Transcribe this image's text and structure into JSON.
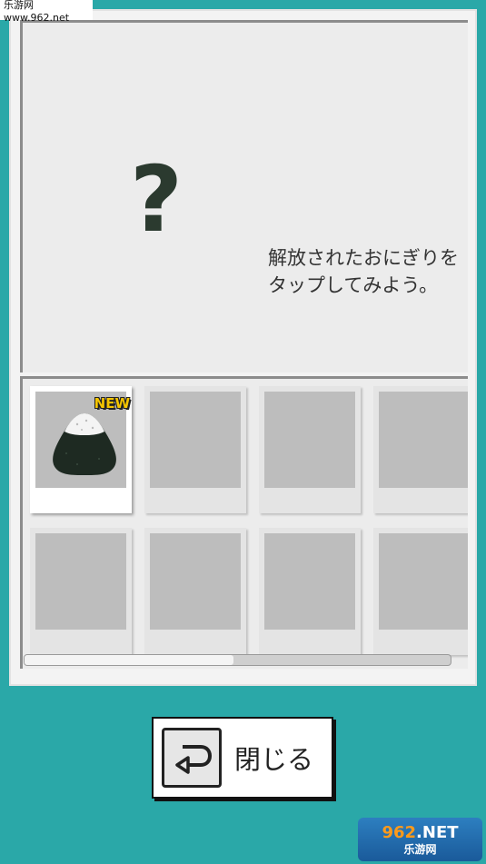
{
  "watermark": {
    "top_text": "乐游网 www.962.net",
    "bottom_logo_num": "962",
    "bottom_logo_suffix": ".NET",
    "bottom_logo_cn": "乐游网"
  },
  "viewer": {
    "placeholder_glyph": "?",
    "hint_text": "解放されたおにぎりをタップしてみよう。"
  },
  "collection": {
    "new_badge": "NEW",
    "tiles": [
      {
        "state": "unlocked",
        "item": "onigiri-icon",
        "is_new": true
      },
      {
        "state": "locked"
      },
      {
        "state": "locked"
      },
      {
        "state": "locked"
      },
      {
        "state": "locked"
      },
      {
        "state": "locked"
      },
      {
        "state": "locked"
      },
      {
        "state": "locked"
      }
    ],
    "scroll_position_fraction": 0.49
  },
  "close_button": {
    "label": "閉じる",
    "icon": "return-arrow-icon"
  },
  "colors": {
    "background": "#2aa8a8",
    "badge_yellow": "#f4c400",
    "seaweed": "#1e2a22"
  }
}
